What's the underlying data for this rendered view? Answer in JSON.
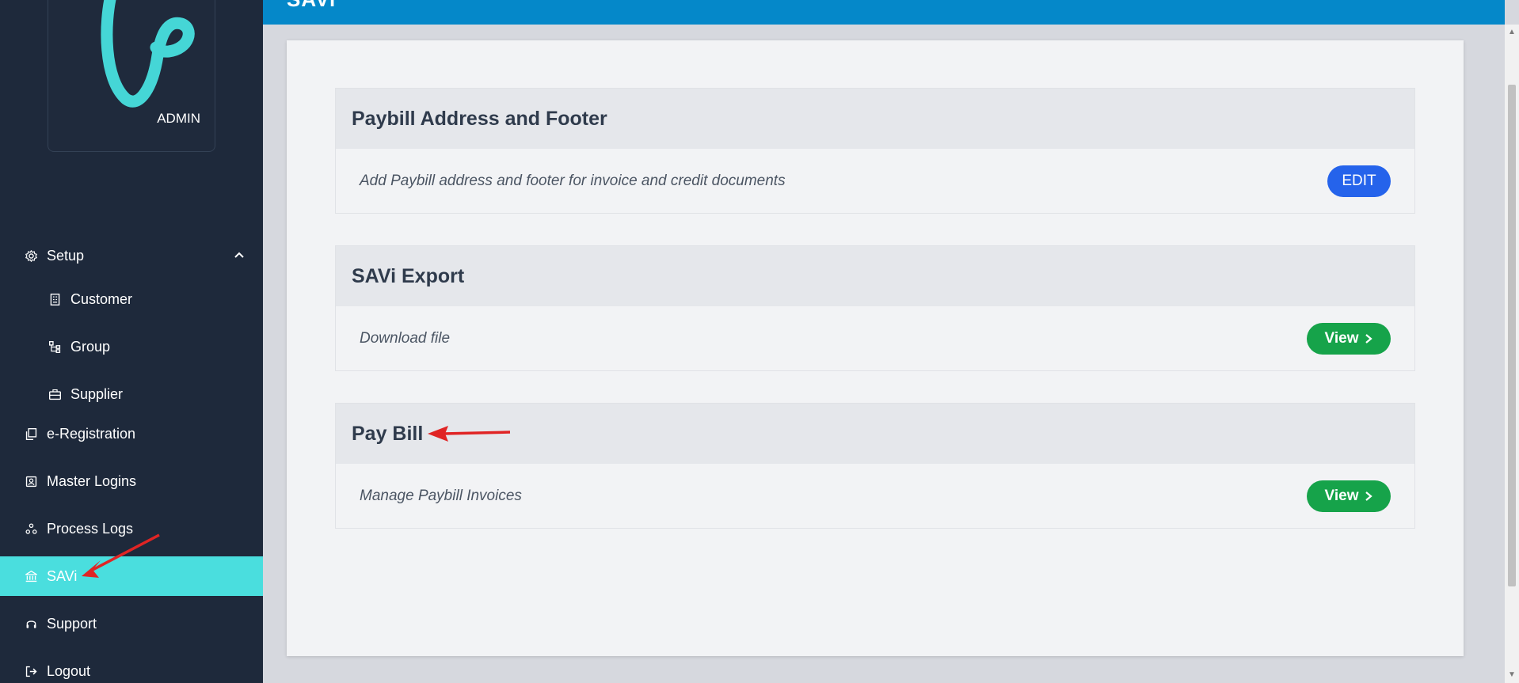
{
  "app": {
    "role_label": "ADMIN",
    "header_title": "SAVi"
  },
  "sidebar": {
    "items": [
      {
        "label": "Setup",
        "icon": "gear-icon",
        "level": "top",
        "expanded": true
      },
      {
        "label": "Customer",
        "icon": "building-icon",
        "level": "sub"
      },
      {
        "label": "Group",
        "icon": "hierarchy-icon",
        "level": "sub"
      },
      {
        "label": "Supplier",
        "icon": "briefcase-icon",
        "level": "sub"
      },
      {
        "label": "e-Registration",
        "icon": "copy-icon",
        "level": "top"
      },
      {
        "label": "Master Logins",
        "icon": "id-card-icon",
        "level": "top"
      },
      {
        "label": "Process Logs",
        "icon": "nodes-icon",
        "level": "top"
      },
      {
        "label": "SAVi",
        "icon": "bank-icon",
        "level": "top",
        "active": true
      },
      {
        "label": "Support",
        "icon": "headset-icon",
        "level": "top"
      },
      {
        "label": "Logout",
        "icon": "logout-icon",
        "level": "top"
      }
    ]
  },
  "panels": [
    {
      "title": "Paybill Address and Footer",
      "description": "Add Paybill address and footer for invoice and credit documents",
      "button": "EDIT"
    },
    {
      "title": "SAVi Export",
      "description": "Download file",
      "button": "View"
    },
    {
      "title": "Pay Bill",
      "description": "Manage Paybill Invoices",
      "button": "View"
    }
  ],
  "colors": {
    "sidebar_bg": "#1e293b",
    "active_item": "#4adede",
    "header_bg": "#0588c9",
    "edit_button": "#2563eb",
    "view_button": "#16a34a",
    "annotation_arrow": "#e02424"
  }
}
